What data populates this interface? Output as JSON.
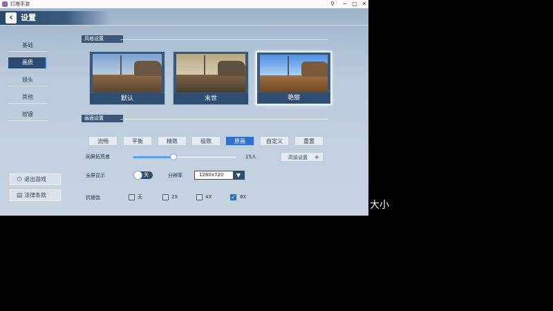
{
  "window": {
    "title": "灯塔手游",
    "controls": {
      "pin": "⚲",
      "minimize": "−",
      "maximize": "□",
      "close": "✕"
    }
  },
  "header": {
    "title": "设置",
    "back_icon": "chevron-left-icon"
  },
  "sidebar": {
    "items": [
      {
        "label": "基础",
        "active": false
      },
      {
        "label": "画质",
        "active": true
      },
      {
        "label": "镜头",
        "active": false
      },
      {
        "label": "其他",
        "active": false
      },
      {
        "label": "按键",
        "active": false
      }
    ],
    "buttons": [
      {
        "label": "退出游戏",
        "icon": "power-icon"
      },
      {
        "label": "法律条款",
        "icon": "document-icon"
      }
    ]
  },
  "style_section": {
    "label": "风格设置",
    "cards": [
      {
        "label": "默认",
        "selected": false
      },
      {
        "label": "末世",
        "selected": false
      },
      {
        "label": "艳丽",
        "selected": true
      }
    ]
  },
  "quality_section": {
    "label": "画面设置",
    "presets": [
      {
        "label": "流畅",
        "active": false
      },
      {
        "label": "平衡",
        "active": false
      },
      {
        "label": "精致",
        "active": false
      },
      {
        "label": "极致",
        "active": false
      },
      {
        "label": "原画",
        "active": true
      },
      {
        "label": "自定义",
        "active": false
      },
      {
        "label": "重置",
        "active": false
      }
    ],
    "crowd": {
      "label": "同屏拓荒者",
      "value_text": "15人",
      "fraction": 0.39
    },
    "advanced": {
      "label": "高级设置",
      "plus": "+"
    },
    "fullscreen": {
      "label": "全屏显示",
      "toggle_text": "关",
      "on": false
    },
    "resolution": {
      "label": "分辨率",
      "value": "1280x720"
    },
    "antialias": {
      "label": "抗锯齿",
      "options": [
        {
          "label": "无",
          "checked": false
        },
        {
          "label": "2X",
          "checked": false
        },
        {
          "label": "4X",
          "checked": false
        },
        {
          "label": "8X",
          "checked": true
        }
      ]
    }
  },
  "overlay": {
    "text": "大小"
  },
  "colors": {
    "accent": "#2f6fd0",
    "panel": "#2f4d70",
    "background": "#b9c9d9"
  }
}
